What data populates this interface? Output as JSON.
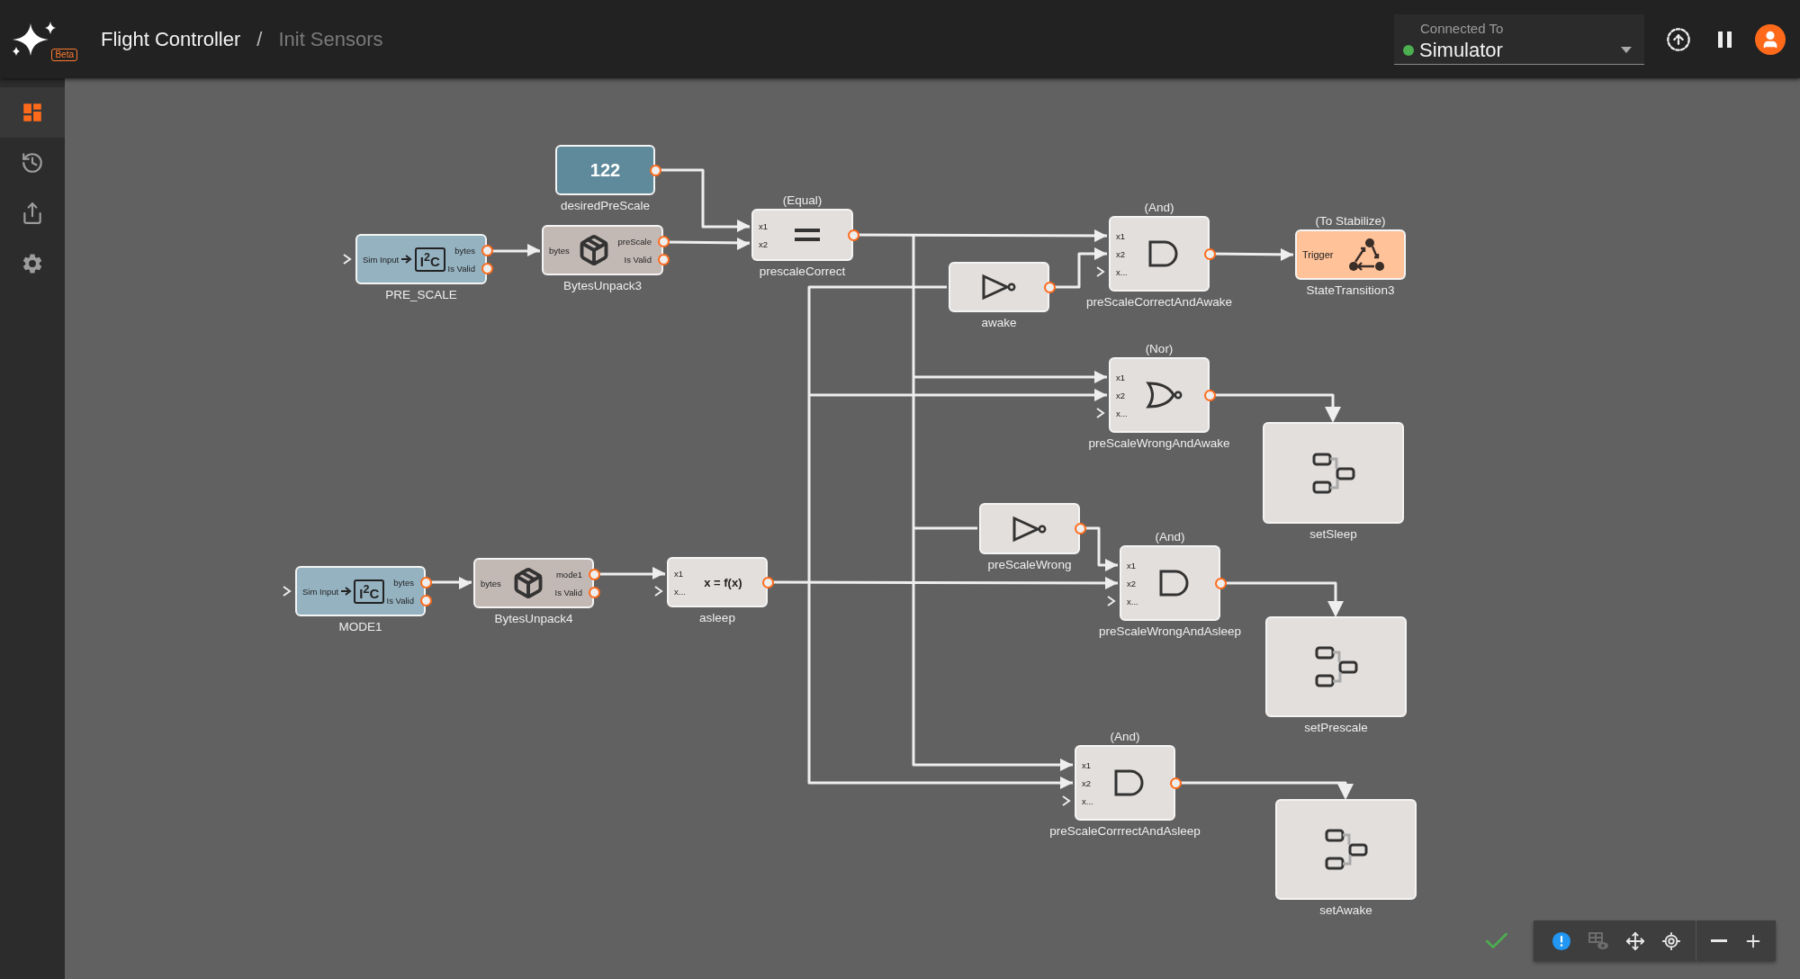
{
  "header": {
    "badge": "Beta",
    "title": "Flight Controller",
    "separator": "/",
    "page": "Init Sensors"
  },
  "connection": {
    "label": "Connected To",
    "value": "Simulator",
    "connected": true
  },
  "sidebar": {
    "items": [
      {
        "kind": "dashboard",
        "selected": true
      },
      {
        "kind": "history",
        "selected": false
      },
      {
        "kind": "share",
        "selected": false
      },
      {
        "kind": "settings",
        "selected": false
      }
    ]
  },
  "nodes": [
    {
      "kind": "constant",
      "name": "desiredPreScale",
      "value": "122"
    },
    {
      "kind": "i2c_input",
      "name": "PRE_SCALE",
      "inputs": [
        {
          "label": "Sim Input",
          "connected": false
        }
      ],
      "badge": "I$^{2}$C",
      "outputs": [
        "bytes",
        "Is Valid"
      ]
    },
    {
      "kind": "bytes_unpack",
      "name": "BytesUnpack3",
      "inputs": [
        {
          "label": "bytes",
          "connected": true
        }
      ],
      "outputs": [
        "preScale",
        "Is Valid"
      ]
    },
    {
      "kind": "equal",
      "header": "(Equal)",
      "name": "prescaleCorrect",
      "inputs": [
        {
          "label": "x1",
          "connected": true
        },
        {
          "label": "x2",
          "connected": true
        }
      ]
    },
    {
      "kind": "and",
      "header": "(And)",
      "name": "preScaleCorrectAndAwake",
      "inputs": [
        {
          "label": "x1",
          "connected": true
        },
        {
          "label": "x2",
          "connected": true
        },
        {
          "label": "x...",
          "connected": false
        }
      ]
    },
    {
      "kind": "state_transition",
      "header": "(To Stabilize)",
      "name": "StateTransition3",
      "inputs": [
        {
          "label": "Trigger",
          "connected": true
        }
      ]
    },
    {
      "kind": "not",
      "name": "awake"
    },
    {
      "kind": "nor",
      "header": "(Nor)",
      "name": "preScaleWrongAndAwake",
      "inputs": [
        {
          "label": "x1",
          "connected": true
        },
        {
          "label": "x2",
          "connected": true
        },
        {
          "label": "x...",
          "connected": false
        }
      ]
    },
    {
      "kind": "state",
      "name": "setSleep"
    },
    {
      "kind": "not",
      "name": "preScaleWrong"
    },
    {
      "kind": "and",
      "header": "(And)",
      "name": "preScaleWrongAndAsleep",
      "inputs": [
        {
          "label": "x1",
          "connected": true
        },
        {
          "label": "x2",
          "connected": true
        },
        {
          "label": "x...",
          "connected": false
        }
      ]
    },
    {
      "kind": "i2c_input",
      "name": "MODE1",
      "inputs": [
        {
          "label": "Sim Input",
          "connected": false
        }
      ],
      "badge": "I$^{2}$C",
      "outputs": [
        "bytes",
        "Is Valid"
      ]
    },
    {
      "kind": "bytes_unpack",
      "name": "BytesUnpack4",
      "inputs": [
        {
          "label": "bytes",
          "connected": true
        }
      ],
      "outputs": [
        "mode1",
        "Is Valid"
      ]
    },
    {
      "kind": "function",
      "name": "asleep",
      "expression": "x = f(x)",
      "inputs": [
        {
          "label": "x1",
          "connected": true
        },
        {
          "label": "x...",
          "connected": false
        }
      ]
    },
    {
      "kind": "state",
      "name": "setPrescale"
    },
    {
      "kind": "and",
      "header": "(And)",
      "name": "preScaleCorrrectAndAsleep",
      "inputs": [
        {
          "label": "x1",
          "connected": true
        },
        {
          "label": "x2",
          "connected": true
        },
        {
          "label": "x...",
          "connected": false
        }
      ]
    },
    {
      "kind": "state",
      "name": "setAwake"
    }
  ],
  "toolbar": [
    {
      "kind": "issues",
      "disabled": false
    },
    {
      "kind": "table-view",
      "disabled": true
    },
    {
      "kind": "pan",
      "disabled": false
    },
    {
      "kind": "center",
      "disabled": false
    },
    {
      "kind": "zoom-out",
      "disabled": false
    },
    {
      "kind": "zoom-in",
      "disabled": false
    }
  ],
  "validation": {
    "valid": true
  }
}
